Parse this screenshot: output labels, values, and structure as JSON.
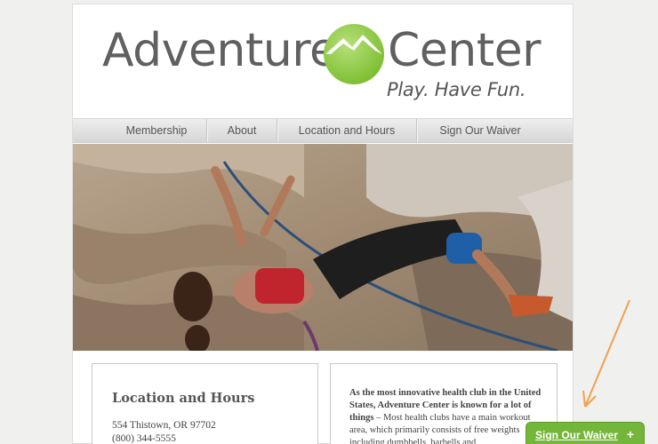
{
  "brand": {
    "name_left": "Adventure",
    "name_right": "Center",
    "tagline": "Play. Have Fun."
  },
  "nav": {
    "items": [
      {
        "label": "Membership"
      },
      {
        "label": "About"
      },
      {
        "label": "Location and Hours"
      },
      {
        "label": "Sign Our Waiver"
      }
    ]
  },
  "location": {
    "title": "Location and Hours",
    "address": "554 Thistown, OR 97702",
    "phone": "(800) 344-5555"
  },
  "about": {
    "lead": "As the most innovative health club in the United States, Adventure Center is known for a lot of things",
    "body": " – Most health clubs have a main workout area, which primarily consists of free weights including dumbbells, barbells and"
  },
  "floating_button": {
    "label": "Sign Our Waiver",
    "icon": "plus-icon",
    "color": "#74b63a"
  },
  "colors": {
    "logo_green": "#8cc63f",
    "text_gray": "#606060",
    "annotation_arrow": "#f0a050"
  }
}
